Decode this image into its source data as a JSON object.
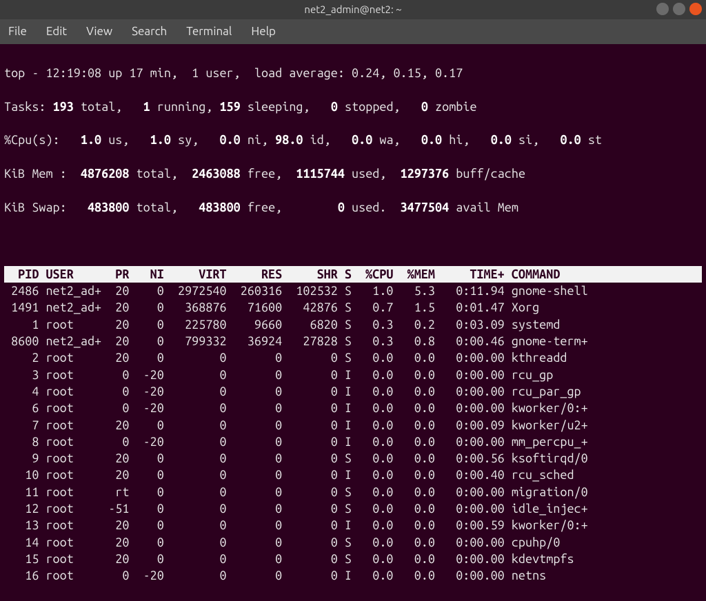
{
  "window": {
    "title": "net2_admin@net2: ~"
  },
  "menu": [
    "File",
    "Edit",
    "View",
    "Search",
    "Terminal",
    "Help"
  ],
  "summary": {
    "time": "12:19:08",
    "uptime": "17 min",
    "users": "1 user",
    "loadavg": "0.24, 0.15, 0.17",
    "tasks": {
      "total": "193",
      "running": "1",
      "sleeping": "159",
      "stopped": "0",
      "zombie": "0"
    },
    "cpu": {
      "us": "1.0",
      "sy": "1.0",
      "ni": "0.0",
      "id": "98.0",
      "wa": "0.0",
      "hi": "0.0",
      "si": "0.0",
      "st": "0.0"
    },
    "mem": {
      "total": "4876208",
      "free": "2463088",
      "used": "1115744",
      "buff": "1297376"
    },
    "swap": {
      "total": "483800",
      "free": "483800",
      "used": "0",
      "avail": "3477504"
    }
  },
  "columns": [
    "PID",
    "USER",
    "PR",
    "NI",
    "VIRT",
    "RES",
    "SHR",
    "S",
    "%CPU",
    "%MEM",
    "TIME+",
    "COMMAND"
  ],
  "rows": [
    {
      "pid": "2486",
      "user": "net2_ad+",
      "pr": "20",
      "ni": "0",
      "virt": "2972540",
      "res": "260316",
      "shr": "102532",
      "s": "S",
      "cpu": "1.0",
      "mem": "5.3",
      "time": "0:11.94",
      "cmd": "gnome-shell"
    },
    {
      "pid": "1491",
      "user": "net2_ad+",
      "pr": "20",
      "ni": "0",
      "virt": "368876",
      "res": "71600",
      "shr": "42876",
      "s": "S",
      "cpu": "0.7",
      "mem": "1.5",
      "time": "0:01.47",
      "cmd": "Xorg"
    },
    {
      "pid": "1",
      "user": "root",
      "pr": "20",
      "ni": "0",
      "virt": "225780",
      "res": "9660",
      "shr": "6820",
      "s": "S",
      "cpu": "0.3",
      "mem": "0.2",
      "time": "0:03.09",
      "cmd": "systemd"
    },
    {
      "pid": "8600",
      "user": "net2_ad+",
      "pr": "20",
      "ni": "0",
      "virt": "799332",
      "res": "36924",
      "shr": "27828",
      "s": "S",
      "cpu": "0.3",
      "mem": "0.8",
      "time": "0:00.46",
      "cmd": "gnome-term+"
    },
    {
      "pid": "2",
      "user": "root",
      "pr": "20",
      "ni": "0",
      "virt": "0",
      "res": "0",
      "shr": "0",
      "s": "S",
      "cpu": "0.0",
      "mem": "0.0",
      "time": "0:00.00",
      "cmd": "kthreadd"
    },
    {
      "pid": "3",
      "user": "root",
      "pr": "0",
      "ni": "-20",
      "virt": "0",
      "res": "0",
      "shr": "0",
      "s": "I",
      "cpu": "0.0",
      "mem": "0.0",
      "time": "0:00.00",
      "cmd": "rcu_gp"
    },
    {
      "pid": "4",
      "user": "root",
      "pr": "0",
      "ni": "-20",
      "virt": "0",
      "res": "0",
      "shr": "0",
      "s": "I",
      "cpu": "0.0",
      "mem": "0.0",
      "time": "0:00.00",
      "cmd": "rcu_par_gp"
    },
    {
      "pid": "6",
      "user": "root",
      "pr": "0",
      "ni": "-20",
      "virt": "0",
      "res": "0",
      "shr": "0",
      "s": "I",
      "cpu": "0.0",
      "mem": "0.0",
      "time": "0:00.00",
      "cmd": "kworker/0:+"
    },
    {
      "pid": "7",
      "user": "root",
      "pr": "20",
      "ni": "0",
      "virt": "0",
      "res": "0",
      "shr": "0",
      "s": "I",
      "cpu": "0.0",
      "mem": "0.0",
      "time": "0:00.09",
      "cmd": "kworker/u2+"
    },
    {
      "pid": "8",
      "user": "root",
      "pr": "0",
      "ni": "-20",
      "virt": "0",
      "res": "0",
      "shr": "0",
      "s": "I",
      "cpu": "0.0",
      "mem": "0.0",
      "time": "0:00.00",
      "cmd": "mm_percpu_+"
    },
    {
      "pid": "9",
      "user": "root",
      "pr": "20",
      "ni": "0",
      "virt": "0",
      "res": "0",
      "shr": "0",
      "s": "S",
      "cpu": "0.0",
      "mem": "0.0",
      "time": "0:00.56",
      "cmd": "ksoftirqd/0"
    },
    {
      "pid": "10",
      "user": "root",
      "pr": "20",
      "ni": "0",
      "virt": "0",
      "res": "0",
      "shr": "0",
      "s": "I",
      "cpu": "0.0",
      "mem": "0.0",
      "time": "0:00.40",
      "cmd": "rcu_sched"
    },
    {
      "pid": "11",
      "user": "root",
      "pr": "rt",
      "ni": "0",
      "virt": "0",
      "res": "0",
      "shr": "0",
      "s": "S",
      "cpu": "0.0",
      "mem": "0.0",
      "time": "0:00.00",
      "cmd": "migration/0"
    },
    {
      "pid": "12",
      "user": "root",
      "pr": "-51",
      "ni": "0",
      "virt": "0",
      "res": "0",
      "shr": "0",
      "s": "S",
      "cpu": "0.0",
      "mem": "0.0",
      "time": "0:00.00",
      "cmd": "idle_injec+"
    },
    {
      "pid": "13",
      "user": "root",
      "pr": "20",
      "ni": "0",
      "virt": "0",
      "res": "0",
      "shr": "0",
      "s": "I",
      "cpu": "0.0",
      "mem": "0.0",
      "time": "0:00.59",
      "cmd": "kworker/0:+"
    },
    {
      "pid": "14",
      "user": "root",
      "pr": "20",
      "ni": "0",
      "virt": "0",
      "res": "0",
      "shr": "0",
      "s": "S",
      "cpu": "0.0",
      "mem": "0.0",
      "time": "0:00.00",
      "cmd": "cpuhp/0"
    },
    {
      "pid": "15",
      "user": "root",
      "pr": "20",
      "ni": "0",
      "virt": "0",
      "res": "0",
      "shr": "0",
      "s": "S",
      "cpu": "0.0",
      "mem": "0.0",
      "time": "0:00.00",
      "cmd": "kdevtmpfs"
    },
    {
      "pid": "16",
      "user": "root",
      "pr": "0",
      "ni": "-20",
      "virt": "0",
      "res": "0",
      "shr": "0",
      "s": "I",
      "cpu": "0.0",
      "mem": "0.0",
      "time": "0:00.00",
      "cmd": "netns"
    }
  ]
}
